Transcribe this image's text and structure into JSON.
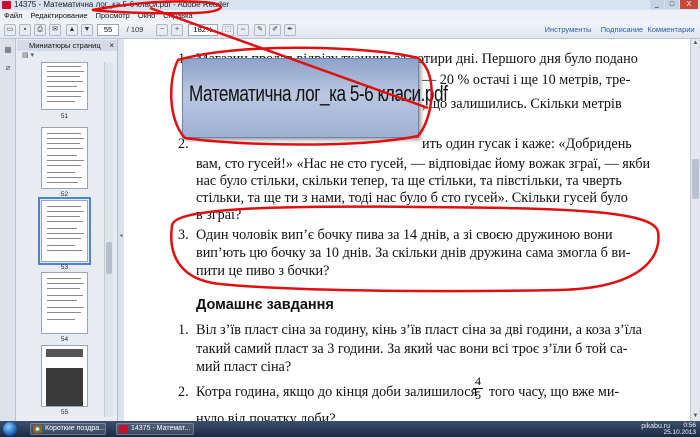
{
  "window": {
    "title": "14375 - Математична лог_ка 5-6 класи.pdf - Adobe Reader",
    "controls": [
      "_",
      "□",
      "X"
    ]
  },
  "menu": [
    "Файл",
    "Редактирование",
    "Просмотр",
    "Окно",
    "Справка"
  ],
  "toolbar": {
    "page_current": "55",
    "page_total": "/ 109",
    "zoom": "182%",
    "right_tabs": [
      "Инструменты",
      "Подписание",
      "Комментарии"
    ]
  },
  "sidebar": {
    "title": "Миниатюры страниц",
    "thumbs": [
      {
        "label": "51"
      },
      {
        "label": "52"
      },
      {
        "label": "53"
      },
      {
        "label": "54"
      },
      {
        "label": "55"
      }
    ]
  },
  "document": {
    "p1_l1": "Магазин продав відрізу тканини за чотири дні. Першого дня було подано",
    "p1_l2": "— 20 % остачі і ще 10 метрів, тре-",
    "p1_l3": ", що залишились. Скільки метрів",
    "p2_l1": "ить один гусак і каже: «Добридень",
    "p2_l2": "вам, сто гусей!» «Нас не сто гусей, — відповідає йому вожак зграї, — якби",
    "p2_l3": "нас було стільки, скільки тепер, та ще стільки, та півстільки, та чверть",
    "p2_l4": "стільки, та ще ти з нами, тоді нас було б сто гусей». Скільки гусей було",
    "p2_l5": "в зграї?",
    "p3_l1": "Один чоловік вип’є бочку пива за 14 днів, а зі своєю дружиною вони",
    "p3_l2": "вип’ють цю бочку за 10 днів. За скільки днів дружина сама змогла б ви-",
    "p3_l3": "пити це пиво з бочки?",
    "homework_title": "Домашнє завдання",
    "h1_l1": "Віл з’їв пласт сіна за годину, кінь з’їв пласт сіна за дві години, а коза з’їла",
    "h1_l2": "такий самий пласт за 3 години. За який час вони всі троє з’їли б той са-",
    "h1_l3": "мий пласт сіна?",
    "h2_l1": "Котра година, якщо до кінця доби залишилося",
    "h2_l2": "того часу, що вже ми-",
    "h2_l3": "нуло від початку доби?",
    "frac_num": "4",
    "frac_den": "5",
    "numbers": [
      "1.",
      "2.",
      "3.",
      "1.",
      "2."
    ]
  },
  "tooltip": {
    "text": "Математична лог_ка 5-6 класи.pdf"
  },
  "taskbar": {
    "items": [
      "Короткие поздра...",
      "14375 - Математ..."
    ],
    "clock_time": "0:56",
    "clock_date": "25.10.2013",
    "watermark": "pikabu.ru"
  },
  "colors": {
    "annotation": "#e01010",
    "accent": "#2b5fa5"
  }
}
